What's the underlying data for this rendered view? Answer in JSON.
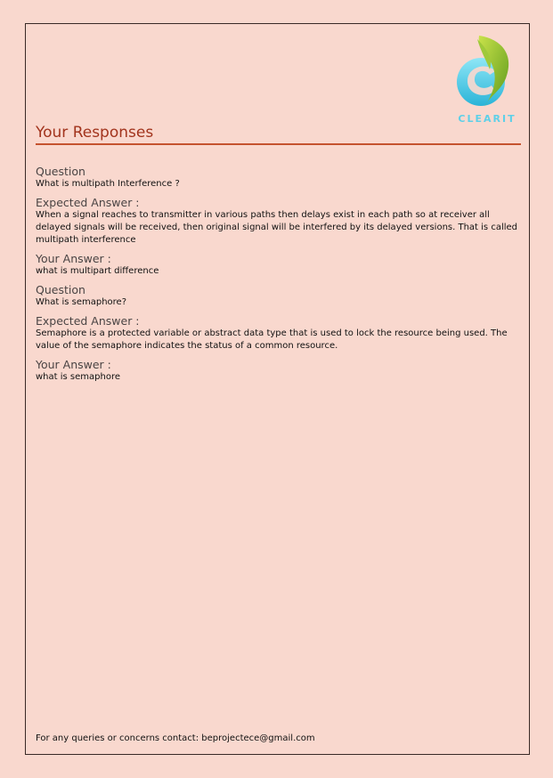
{
  "logo": {
    "text": "CLEARIT"
  },
  "page_title": "Your Responses",
  "responses": [
    {
      "question_label": "Question",
      "question": "What is multipath Interference ?",
      "expected_label": "Expected Answer :",
      "expected": "When a signal reaches to transmitter in various paths then delays exist in each path so at receiver all delayed signals will be received, then original signal will be interfered by its delayed versions. That is called multipath interference",
      "your_label": "Your Answer :",
      "your_answer": "what is multipart difference"
    },
    {
      "question_label": "Question",
      "question": "What is semaphore?",
      "expected_label": "Expected Answer :",
      "expected": "Semaphore is a protected variable or abstract data type that is used to lock the resource being used. The value of the semaphore indicates the status of a common resource.",
      "your_label": "Your Answer :",
      "your_answer": "what is semaphore"
    }
  ],
  "footer": "For any queries or concerns contact: beprojectece@gmail.com",
  "colors": {
    "background": "#f9d8ce",
    "title": "#a2341d",
    "rule": "#c5532f",
    "heading": "#4a4444"
  }
}
